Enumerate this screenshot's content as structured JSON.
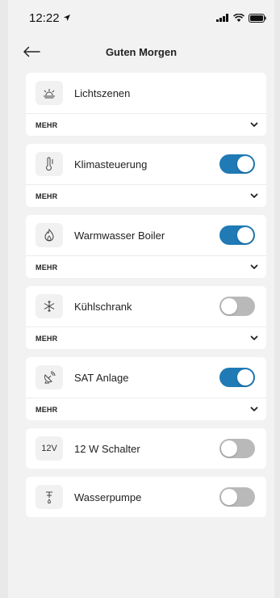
{
  "status_bar": {
    "time": "12:22"
  },
  "nav": {
    "title": "Guten Morgen"
  },
  "more_label": "MEHR",
  "cards": [
    {
      "label": "Lichtszenen",
      "icon": "light-scene-icon",
      "has_toggle": false,
      "toggle_on": null,
      "has_more": true
    },
    {
      "label": "Klimasteuerung",
      "icon": "thermometer-icon",
      "has_toggle": true,
      "toggle_on": true,
      "has_more": true
    },
    {
      "label": "Warmwasser Boiler",
      "icon": "flame-icon",
      "has_toggle": true,
      "toggle_on": true,
      "has_more": true
    },
    {
      "label": "Kühlschrank",
      "icon": "snowflake-icon",
      "has_toggle": true,
      "toggle_on": false,
      "has_more": true
    },
    {
      "label": "SAT Anlage",
      "icon": "satellite-dish-icon",
      "has_toggle": true,
      "toggle_on": true,
      "has_more": true
    },
    {
      "label": "12 W Schalter",
      "icon": "12v-icon",
      "icon_text": "12V",
      "has_toggle": true,
      "toggle_on": false,
      "has_more": false
    },
    {
      "label": "Wasserpumpe",
      "icon": "water-tap-icon",
      "has_toggle": true,
      "toggle_on": false,
      "has_more": false
    }
  ],
  "colors": {
    "toggle_on": "#1f7ab5",
    "toggle_off": "#b9b9b9",
    "background": "#f2f2f2"
  }
}
